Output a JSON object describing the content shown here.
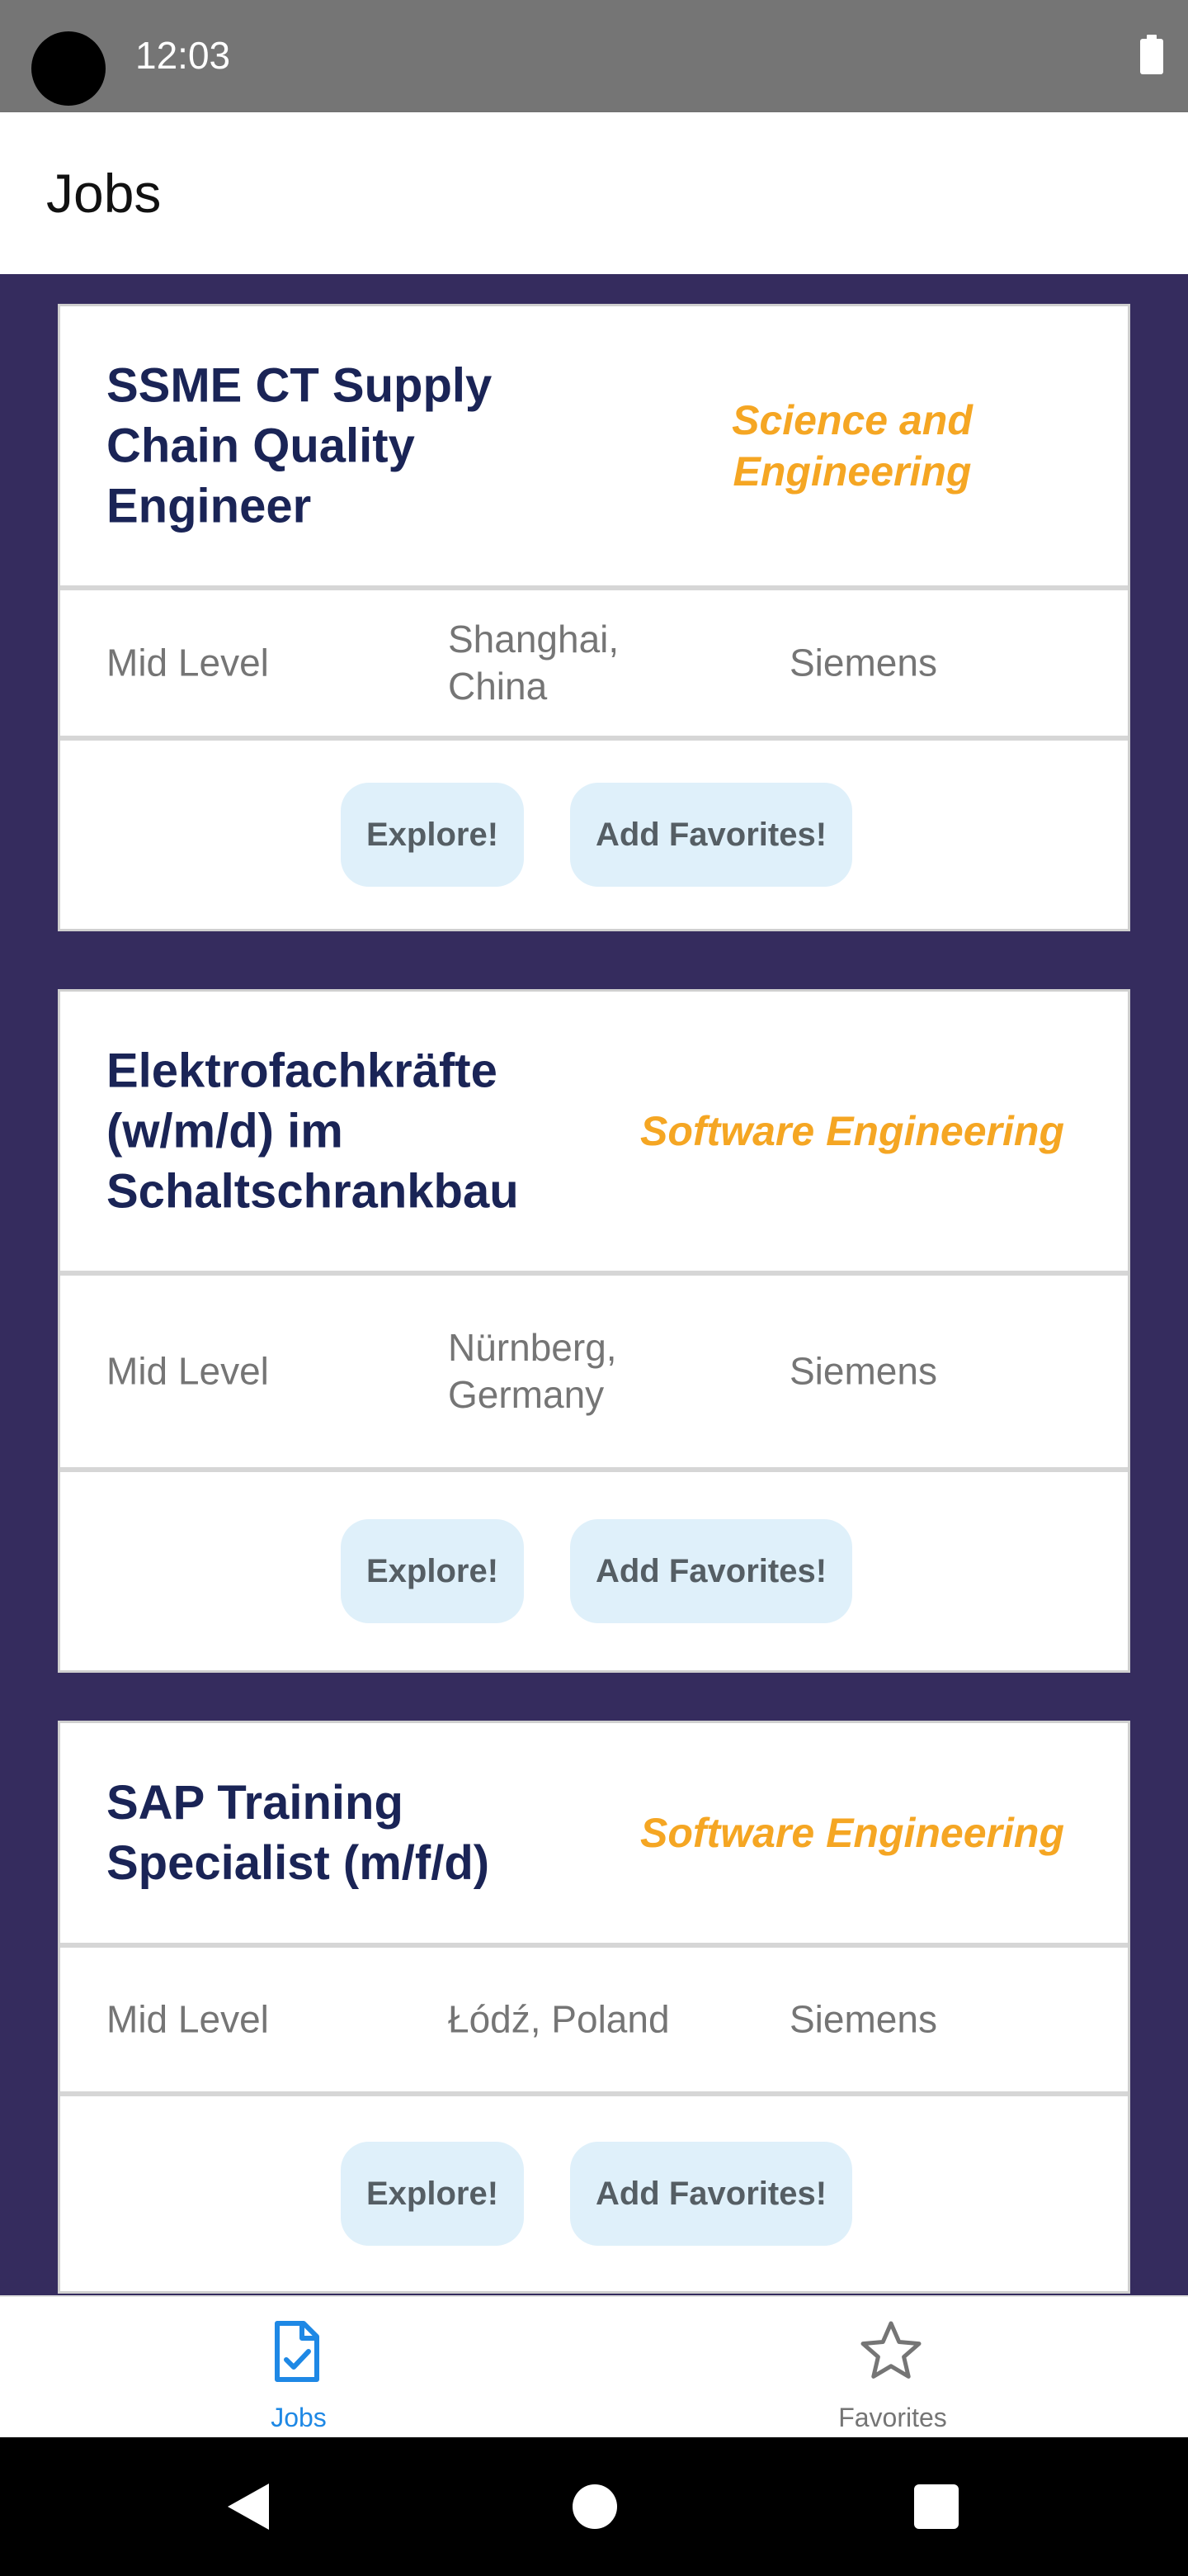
{
  "status_bar": {
    "time": "12:03"
  },
  "app_bar": {
    "title": "Jobs"
  },
  "jobs": [
    {
      "title": "SSME CT Supply Chain Quality Engineer",
      "category": "Science and Engineering",
      "level": "Mid Level",
      "location": "Shanghai, China",
      "company": "Siemens",
      "explore_label": "Explore!",
      "favorite_label": "Add Favorites!"
    },
    {
      "title": "Elektrofachkräfte (w/m/d) im Schaltschrankbau",
      "category": "Software Engineering",
      "level": "Mid Level",
      "location": "Nürnberg, Germany",
      "company": "Siemens",
      "explore_label": "Explore!",
      "favorite_label": "Add Favorites!"
    },
    {
      "title": "SAP Training Specialist (m/f/d)",
      "category": "Software Engineering",
      "level": "Mid Level",
      "location": "Łódź, Poland",
      "company": "Siemens",
      "explore_label": "Explore!",
      "favorite_label": "Add Favorites!"
    }
  ],
  "bottom_nav": {
    "items": [
      {
        "label": "Jobs",
        "icon": "job-document-check-icon",
        "active": true
      },
      {
        "label": "Favorites",
        "icon": "star-outline-icon",
        "active": false
      }
    ]
  },
  "colors": {
    "background": "#352c5e",
    "title": "#1a2456",
    "category": "#f5a623",
    "button_bg": "#dff0fa",
    "active_nav": "#1e88e5"
  }
}
